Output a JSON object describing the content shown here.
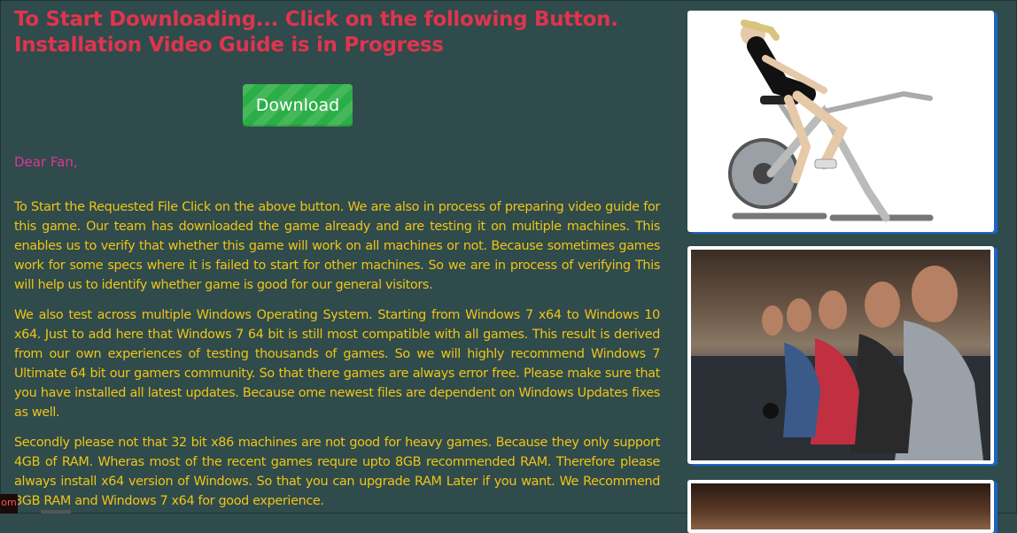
{
  "main": {
    "title": "To Start Downloading... Click on the following Button. Installation Video Guide is in Progress",
    "download_label": "Download",
    "greeting": "Dear Fan,",
    "paragraphs": [
      "To Start the Requested File Click on the above button. We are also in process of preparing video guide for this game. Our team has downloaded the game already and are testing it on multiple machines. This enables us to verify that whether this game will work on all machines or not. Because sometimes games work for some specs where it is failed to start for other machines. So we are in process of verifying This will help us to identify whether game is good for our general visitors.",
      "We also test across multiple Windows Operating System. Starting from Windows 7 x64 to Windows 10 x64. Just to add here that Windows 7 64 bit is still most compatible with all games. This result is derived from our own experiences of testing thousands of games. So we will highly recommend Windows 7 Ultimate 64 bit our gamers community. So that there games are always error free. Please make sure that you have installed all latest updates. Because ome newest files are dependent on Windows Updates fixes as well.",
      "Secondly please not that 32 bit x86 machines are not good for heavy games. Because they only support 4GB of RAM. Wheras most of the recent games requre upto 8GB recommended RAM. Therefore please always install x64 version of Windows. So that you can upgrade RAM Later if you want. We Recommend 8GB RAM and Windows 7 x64 for good experience."
    ]
  },
  "sidebar": {
    "ads": [
      {
        "icon": "exercise-bike-photo"
      },
      {
        "icon": "gym-class-photo"
      },
      {
        "icon": "portrait-photo"
      }
    ]
  },
  "taskbar": {
    "tag": "om"
  },
  "colors": {
    "background": "#2f4b4b",
    "title": "#e0344e",
    "greeting": "#e0349c",
    "body_text": "#f0c419",
    "button": "#2cae46",
    "card_shadow": "#1e63c8"
  }
}
